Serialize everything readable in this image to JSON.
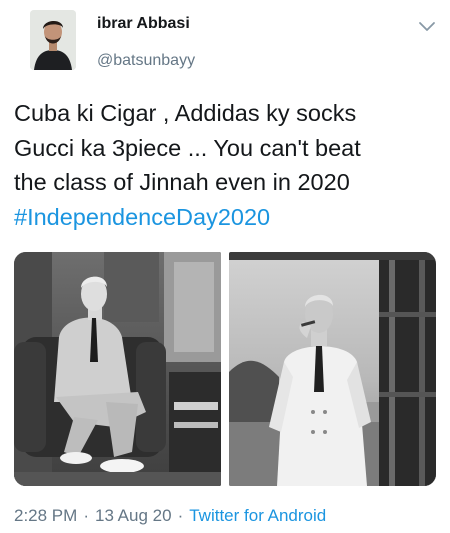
{
  "user": {
    "display_name": "ibrar Abbasi",
    "handle": "@batsunbayy",
    "avatar_icon": "user-avatar"
  },
  "tweet": {
    "text_lines": [
      "Cuba ki Cigar , Addidas ky socks",
      "Gucci ka 3piece ... You can't beat",
      "the class of Jinnah even in 2020"
    ],
    "hashtag": "#IndependenceDay2020",
    "media_count": 2
  },
  "meta": {
    "time": "2:28 PM",
    "separator": "·",
    "date": "13 Aug 20",
    "source": "Twitter for Android"
  },
  "icons": {
    "more": "chevron-down-icon"
  },
  "colors": {
    "link": "#1b95e0",
    "secondary": "#657786",
    "primary_text": "#14171a"
  }
}
